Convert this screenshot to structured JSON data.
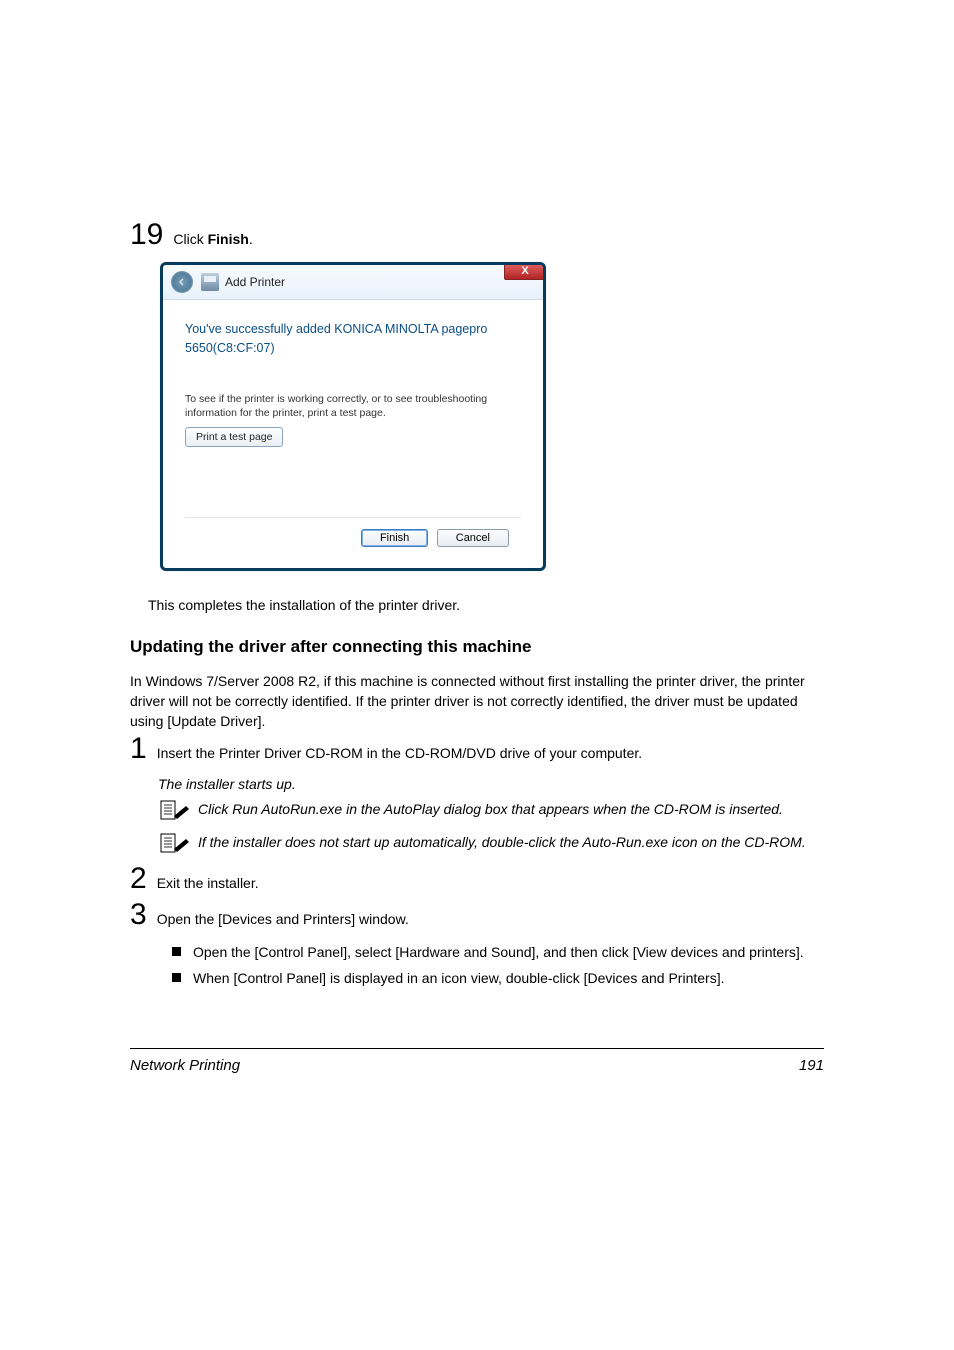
{
  "step19": {
    "num": "19",
    "text_prefix": "Click ",
    "text_bold": "Finish",
    "text_suffix": "."
  },
  "dialog": {
    "title": "Add Printer",
    "close": "X",
    "heading_l1": "You've successfully added KONICA MINOLTA pagepro",
    "heading_l2": "5650(C8:CF:07)",
    "help": "To see if the printer is working correctly, or to see troubleshooting information for the printer, print a test page.",
    "test_btn": "Print a test page",
    "finish": "Finish",
    "cancel": "Cancel"
  },
  "after_dialog": "This completes the installation of the printer driver.",
  "h2": "Updating the driver after connecting this machine",
  "intro": "In Windows 7/Server 2008 R2, if this machine is connected without first installing the printer driver, the printer driver will not be correctly identified. If the printer driver is not correctly identified, the driver must be updated using [Update Driver].",
  "step1": {
    "num": "1",
    "text": "Insert the Printer Driver CD-ROM in the CD-ROM/DVD drive of your computer."
  },
  "installer_starts": "The installer starts up.",
  "note1": "Click Run AutoRun.exe in the AutoPlay dialog box that appears when the CD-ROM is inserted.",
  "note2": "If the installer does not start up automatically, double-click the Auto-Run.exe icon on the CD-ROM.",
  "step2": {
    "num": "2",
    "text": "Exit the installer."
  },
  "step3": {
    "num": "3",
    "text": "Open the [Devices and Printers] window."
  },
  "bullet1": "Open the [Control Panel], select [Hardware and Sound], and then click [View devices and printers].",
  "bullet2": "When [Control Panel] is displayed in an icon view, double-click [Devices and Printers].",
  "footer": {
    "left": "Network Printing",
    "right": "191"
  }
}
